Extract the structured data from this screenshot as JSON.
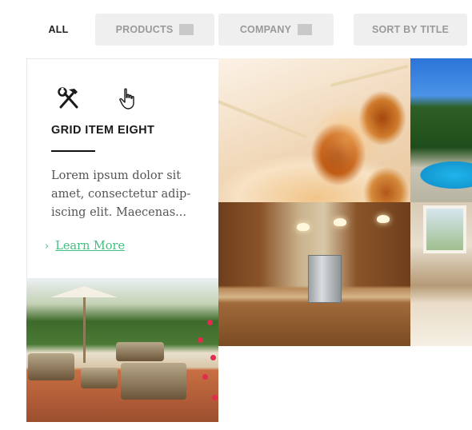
{
  "filters": {
    "all": "ALL",
    "products": "PRODUCTS",
    "company": "COMPANY",
    "sort": "SORT BY TITLE"
  },
  "card": {
    "title": "GRID ITEM EIGHT",
    "body": "Lorem ipsum dolor sit amet, consectetur adip-iscing elit. Maecenas...",
    "link_label": "Learn More",
    "link_chevron": "›",
    "icons": [
      "tools-icon",
      "hand-pointer-icon"
    ]
  },
  "photos": [
    "caramel-apple-photo",
    "pool-photo",
    "kitchen-photo",
    "living-room-photo",
    "patio-photo"
  ],
  "colors": {
    "accent": "#3fc07f",
    "filter_bg": "#efefef",
    "filter_text": "#9a9a9a",
    "active_text": "#222222"
  }
}
